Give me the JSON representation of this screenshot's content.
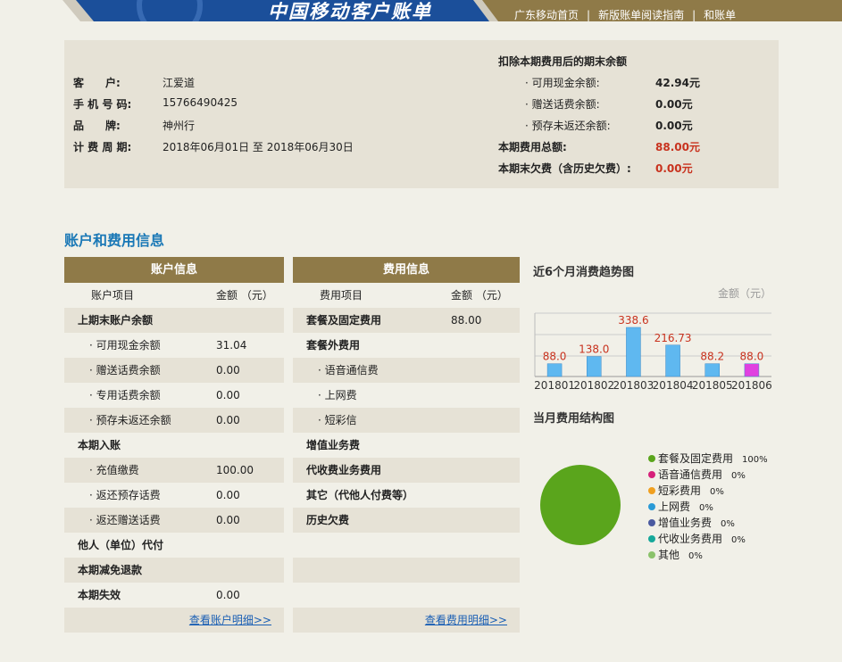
{
  "header": {
    "title": "中国移动客户账单",
    "links": [
      "广东移动首页",
      "新版账单阅读指南",
      "和账单"
    ]
  },
  "summary": {
    "customer_label": "客　　户:",
    "customer": "江爱道",
    "phone_label": "手 机 号 码:",
    "phone": "15766490425",
    "brand_label": "品　　牌:",
    "brand": "神州行",
    "period_label": "计 费 周 期:",
    "period": "2018年06月01日 至 2018年06月30日",
    "balance_heading": "扣除本期费用后的期末余额",
    "cash_label": "· 可用现金余额:",
    "cash": "42.94元",
    "gift_label": "· 赠送话费余额:",
    "gift": "0.00元",
    "prepaid_label": "· 预存未返还余额:",
    "prepaid": "0.00元",
    "total_label": "本期费用总额:",
    "total": "88.00元",
    "owed_label": "本期末欠费（含历史欠费）:",
    "owed": "0.00元"
  },
  "section_title": "账户和费用信息",
  "account_table": {
    "header": "账户信息",
    "col1": "账户项目",
    "col2": "金额 （元）",
    "rows": [
      {
        "label": "上期末账户余额",
        "value": "",
        "bold": true
      },
      {
        "label": "· 可用现金余额",
        "value": "31.04"
      },
      {
        "label": "· 赠送话费余额",
        "value": "0.00"
      },
      {
        "label": "· 专用话费余额",
        "value": "0.00"
      },
      {
        "label": "· 预存未返还余额",
        "value": "0.00"
      },
      {
        "label": "本期入账",
        "value": "",
        "bold": true
      },
      {
        "label": "· 充值缴费",
        "value": "100.00"
      },
      {
        "label": "· 返还预存话费",
        "value": "0.00"
      },
      {
        "label": "· 返还赠送话费",
        "value": "0.00"
      },
      {
        "label": "他人（单位）代付",
        "value": "",
        "bold": true
      },
      {
        "label": "本期减免退款",
        "value": "",
        "bold": true
      },
      {
        "label": "本期失效",
        "value": "0.00",
        "bold": true
      }
    ],
    "link": "查看账户明细>>"
  },
  "fee_table": {
    "header": "费用信息",
    "col1": "费用项目",
    "col2": "金额 （元）",
    "rows": [
      {
        "label": "套餐及固定费用",
        "value": "88.00",
        "bold": true
      },
      {
        "label": "套餐外费用",
        "value": "",
        "bold": true
      },
      {
        "label": "· 语音通信费",
        "value": ""
      },
      {
        "label": "· 上网费",
        "value": ""
      },
      {
        "label": "· 短彩信",
        "value": ""
      },
      {
        "label": "增值业务费",
        "value": "",
        "bold": true
      },
      {
        "label": "代收费业务费用",
        "value": "",
        "bold": true
      },
      {
        "label": "其它（代他人付费等）",
        "value": "",
        "bold": true
      },
      {
        "label": "历史欠费",
        "value": "",
        "bold": true
      },
      {
        "label": "",
        "value": ""
      },
      {
        "label": "",
        "value": ""
      },
      {
        "label": "",
        "value": ""
      }
    ],
    "link": "查看费用明细>>"
  },
  "trend_title": "近6个月消费趋势图",
  "pie_title": "当月费用结构图",
  "chart_data": [
    {
      "type": "bar",
      "title": "近6个月消费趋势图",
      "ylabel": "金额（元）",
      "categories": [
        "201801",
        "201802",
        "201803",
        "201804",
        "201805",
        "201806"
      ],
      "values": [
        88.0,
        138.0,
        338.6,
        216.73,
        88.2,
        88.0
      ],
      "value_labels": [
        "88.0",
        "138.0",
        "338.6",
        "216.73",
        "88.2",
        "88.0"
      ],
      "colors": [
        "#5fb8f0",
        "#5fb8f0",
        "#5fb8f0",
        "#5fb8f0",
        "#5fb8f0",
        "#e040e0"
      ],
      "grid": true
    },
    {
      "type": "pie",
      "title": "当月费用结构图",
      "legend": "right",
      "slices": [
        {
          "name": "套餐及固定费用",
          "pct": "100%",
          "value": 100,
          "color": "#5aa51c"
        },
        {
          "name": "语音通信费用",
          "pct": "0%",
          "value": 0,
          "color": "#d6217a"
        },
        {
          "name": "短彩费用",
          "pct": "0%",
          "value": 0,
          "color": "#f0a020"
        },
        {
          "name": "上网费",
          "pct": "0%",
          "value": 0,
          "color": "#2a9ad6"
        },
        {
          "name": "增值业务费",
          "pct": "0%",
          "value": 0,
          "color": "#4a5aa0"
        },
        {
          "name": "代收业务费用",
          "pct": "0%",
          "value": 0,
          "color": "#16a89a"
        },
        {
          "name": "其他",
          "pct": "0%",
          "value": 0,
          "color": "#8ac26a"
        }
      ]
    }
  ]
}
